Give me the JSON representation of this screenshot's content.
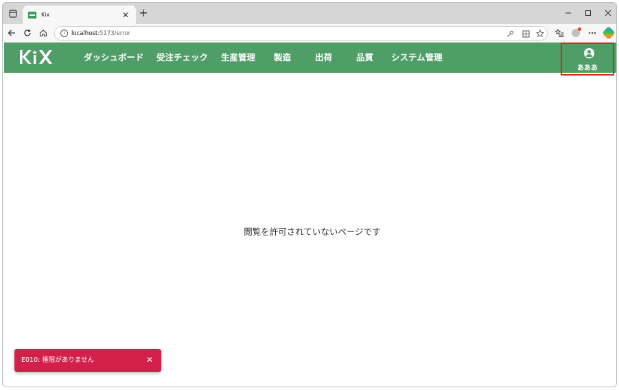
{
  "browser": {
    "tab": {
      "title": "Kix",
      "favicon": "kix-favicon-icon"
    },
    "address": {
      "host": "localhost",
      "path": ":5173/error"
    },
    "window_controls": [
      "minimize-icon",
      "maximize-icon",
      "close-icon"
    ]
  },
  "app": {
    "logo": "KiX",
    "brand_color": "#4f9e67",
    "nav": [
      {
        "label": "ダッシュボード"
      },
      {
        "label": "受注チェック"
      },
      {
        "label": "生産管理"
      },
      {
        "label": "製造"
      },
      {
        "label": "出荷"
      },
      {
        "label": "品質"
      },
      {
        "label": "システム管理"
      }
    ],
    "user": {
      "name": "あああ",
      "icon": "user-circle-icon",
      "highlight_color": "#d9261c"
    }
  },
  "main": {
    "message": "閲覧を許可されていないページです"
  },
  "toast": {
    "text": "E010: 権限がありません",
    "color": "#d2204a",
    "close_icon": "close-icon"
  }
}
